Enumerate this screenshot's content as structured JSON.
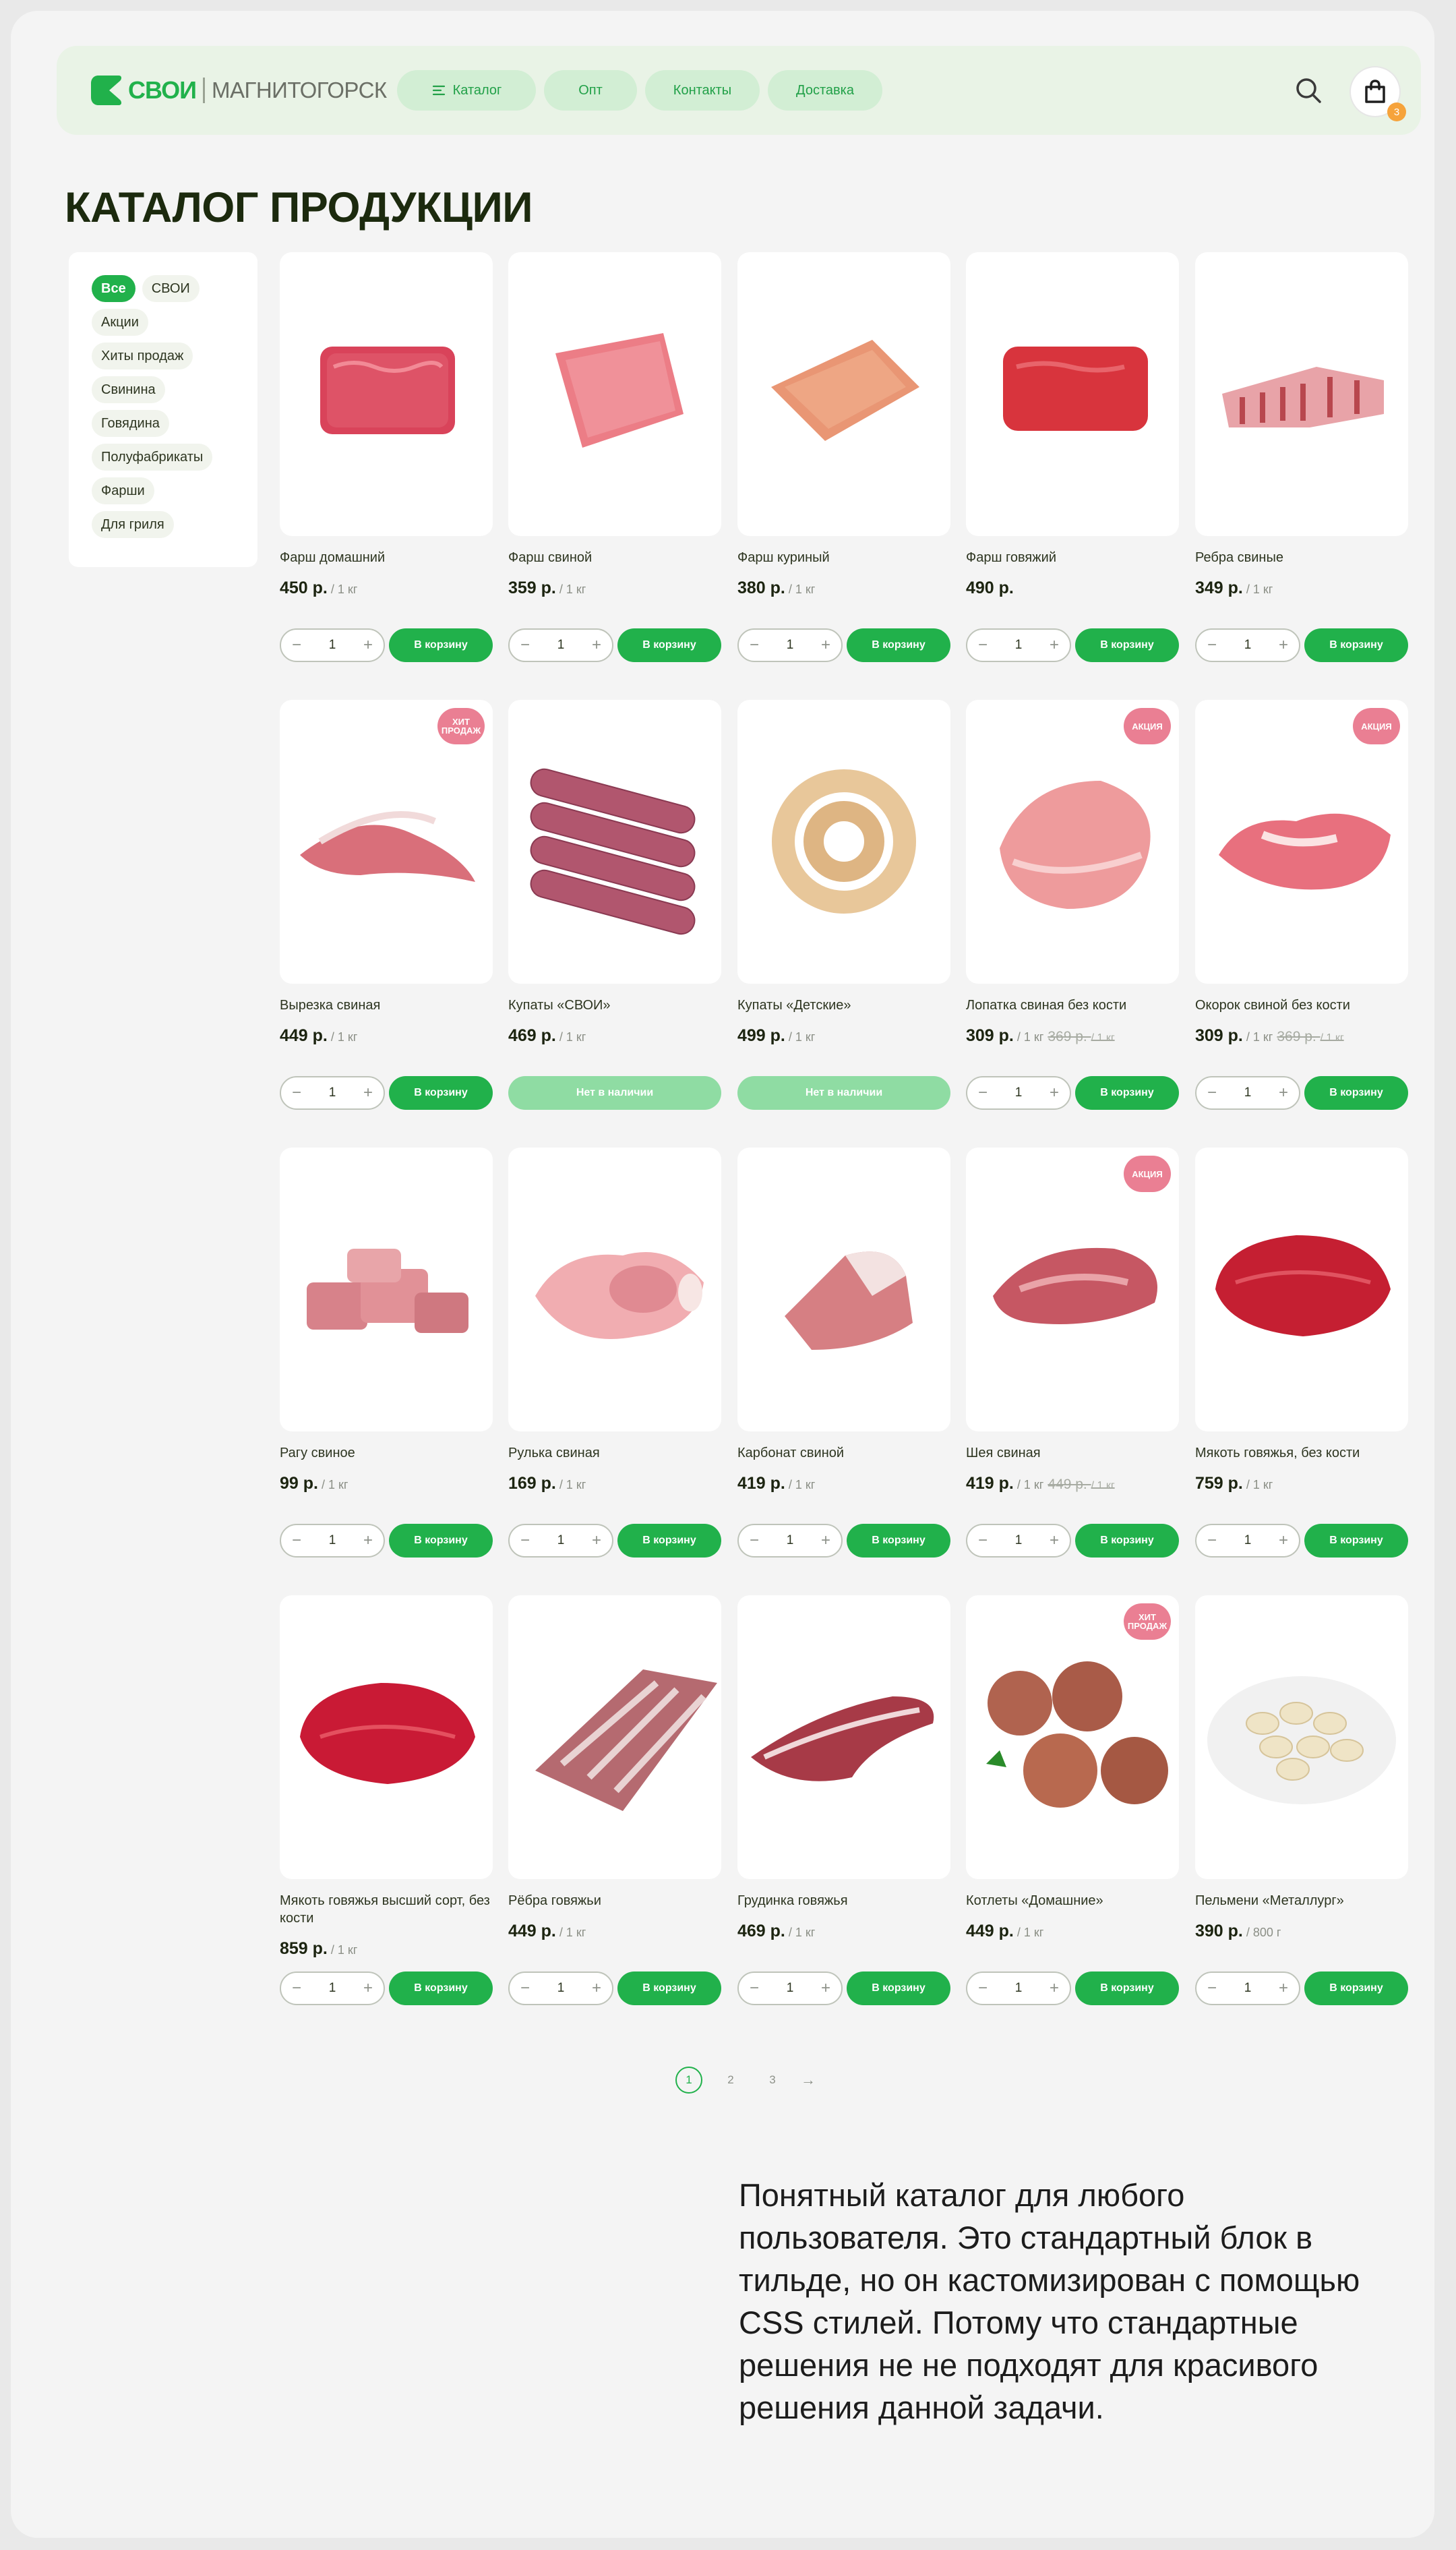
{
  "header": {
    "logo_brand": "СВОИ",
    "logo_city": "МАГНИТОГОРСК",
    "nav": [
      {
        "label": "Каталог",
        "icon": "menu-icon"
      },
      {
        "label": "Опт"
      },
      {
        "label": "Контакты"
      },
      {
        "label": "Доставка"
      }
    ],
    "search_icon": "search-icon",
    "cart_icon": "shopping-bag-icon",
    "cart_count": "3"
  },
  "page_title": "КАТАЛОГ ПРОДУКЦИИ",
  "filters": [
    {
      "label": "Все",
      "active": true
    },
    {
      "label": "СВОИ"
    },
    {
      "label": "Акции"
    },
    {
      "label": "Хиты продаж"
    },
    {
      "label": "Свинина"
    },
    {
      "label": "Говядина"
    },
    {
      "label": "Полуфабрикаты"
    },
    {
      "label": "Фарши"
    },
    {
      "label": "Для гриля"
    }
  ],
  "labels": {
    "buy": "В корзину",
    "unavailable": "Нет в наличии",
    "hit": "ХИТ ПРОДАЖ",
    "sale": "АКЦИЯ",
    "qty_default": "1",
    "minus": "−",
    "plus": "+"
  },
  "products": [
    {
      "name": "Фарш домашний",
      "price": "450 р.",
      "unit": "/ 1 кг",
      "image": "minced-meat"
    },
    {
      "name": "Фарш свиной",
      "price": "359 р.",
      "unit": "/ 1 кг",
      "image": "minced-pork"
    },
    {
      "name": "Фарш куриный",
      "price": "380 р.",
      "unit": "/ 1 кг",
      "image": "minced-chicken"
    },
    {
      "name": "Фарш говяжий",
      "price": "490 р.",
      "unit": "",
      "image": "minced-beef"
    },
    {
      "name": "Ребра свиные",
      "price": "349 р.",
      "unit": "/ 1 кг",
      "image": "pork-ribs"
    },
    {
      "name": "Вырезка свиная",
      "price": "449 р.",
      "unit": "/ 1 кг",
      "tag": "ХИТ ПРОДАЖ",
      "image": "pork-tenderloin"
    },
    {
      "name": "Купаты «СВОИ»",
      "price": "469 р.",
      "unit": "/ 1 кг",
      "unavailable": true,
      "image": "sausages"
    },
    {
      "name": "Купаты «Детские»",
      "price": "499 р.",
      "unit": "/ 1 кг",
      "unavailable": true,
      "image": "sausage-coil"
    },
    {
      "name": "Лопатка свиная без кости",
      "price": "309 р.",
      "unit": "/ 1 кг",
      "old_price": "369 р.",
      "old_unit": "/ 1 кг",
      "tag": "АКЦИЯ",
      "image": "pork-shoulder"
    },
    {
      "name": "Окорок свиной без кости",
      "price": "309 р.",
      "unit": "/ 1 кг",
      "old_price": "369 р.",
      "old_unit": "/ 1 кг",
      "tag": "АКЦИЯ",
      "image": "pork-ham"
    },
    {
      "name": "Рагу свиное",
      "price": "99 р.",
      "unit": "/ 1 кг",
      "image": "pork-stew"
    },
    {
      "name": "Рулька свиная",
      "price": "169 р.",
      "unit": "/ 1 кг",
      "image": "pork-knuckle"
    },
    {
      "name": "Карбонат свиной",
      "price": "419 р.",
      "unit": "/ 1 кг",
      "image": "pork-loin"
    },
    {
      "name": "Шея свиная",
      "price": "419 р.",
      "unit": "/ 1 кг",
      "old_price": "449 р.",
      "old_unit": "/ 1 кг",
      "tag": "АКЦИЯ",
      "image": "pork-neck"
    },
    {
      "name": "Мякоть говяжья, без кости",
      "price": "759 р.",
      "unit": "/ 1 кг",
      "image": "beef-chunk"
    },
    {
      "name": "Мякоть говяжья высший сорт, без кости",
      "price": "859 р.",
      "unit": "/ 1 кг",
      "image": "beef-premium"
    },
    {
      "name": "Рёбра говяжьи",
      "price": "449 р.",
      "unit": "/ 1 кг",
      "image": "beef-ribs"
    },
    {
      "name": "Грудинка говяжья",
      "price": "469 р.",
      "unit": "/ 1 кг",
      "image": "beef-brisket"
    },
    {
      "name": "Котлеты «Домашние»",
      "price": "449 р.",
      "unit": "/ 1 кг",
      "tag": "ХИТ ПРОДАЖ",
      "image": "cutlets"
    },
    {
      "name": "Пельмени «Металлург»",
      "price": "390 р.",
      "unit": "/ 800 г",
      "image": "dumplings"
    }
  ],
  "pagination": {
    "pages": [
      "1",
      "2",
      "3"
    ],
    "current": "1",
    "next_icon": "arrow-right-icon"
  },
  "note": "Понятный каталог для любого пользователя. Это стандартный блок в тильде, но он кастомизирован с помощью CSS стилей. Потому что стандартные решения не не подходят для красивого решения данной задачи."
}
